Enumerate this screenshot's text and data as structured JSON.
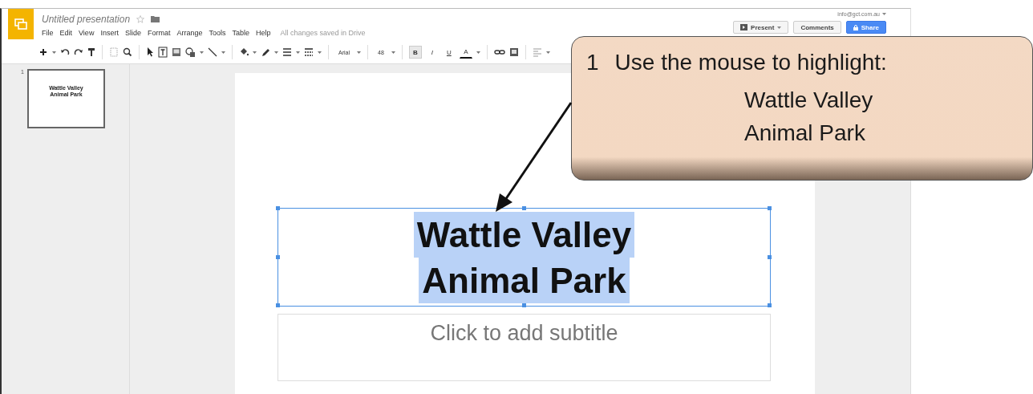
{
  "app": {
    "title": "Untitled presentation",
    "starred": false,
    "menu": [
      "File",
      "Edit",
      "View",
      "Insert",
      "Slide",
      "Format",
      "Arrange",
      "Tools",
      "Table",
      "Help"
    ],
    "save_status": "All changes saved in Drive",
    "account": "info@gct.com.au",
    "buttons": [
      {
        "label": "Present",
        "kind": "split"
      },
      {
        "label": "Comments",
        "kind": "plain"
      },
      {
        "label": "Share",
        "kind": "primary"
      }
    ]
  },
  "toolbar": {
    "font": "Arial",
    "font_size": "48",
    "format_buttons": [
      {
        "label": "B",
        "selected": true
      },
      {
        "label": "I",
        "selected": false
      },
      {
        "label": "U",
        "selected": false
      },
      {
        "label": "A",
        "selected": false
      }
    ]
  },
  "filmstrip": {
    "slides": [
      {
        "number": "1",
        "title_lines": [
          "Wattle Valley",
          "Animal Park"
        ],
        "selected": true
      }
    ]
  },
  "slide": {
    "title_lines": [
      "Wattle Valley",
      "Animal Park"
    ],
    "title_highlighted": true,
    "subtitle_placeholder": "Click to add subtitle"
  },
  "callout": {
    "step": "1",
    "instruction": "Use the mouse to highlight:",
    "lines": [
      "Wattle Valley",
      "Animal Park"
    ]
  }
}
